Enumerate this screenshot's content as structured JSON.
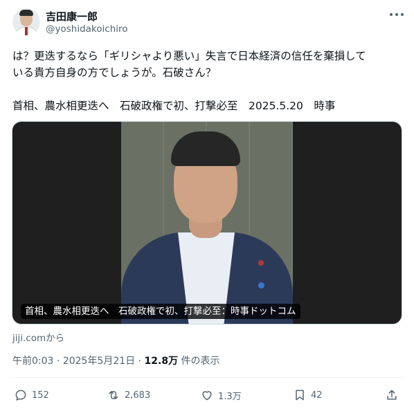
{
  "author": {
    "display_name": "吉田康一郎",
    "handle": "@yoshidakoichiro"
  },
  "tweet": {
    "text": "は？更迭するなら「ギリシャより悪い」失言で日本経済の信任を棄損して\nいる貴方自身の方でしょうが。石破さん？",
    "headline": "首相、農水相更迭へ　石破政権で初、打撃必至　2025.5.20　時事"
  },
  "media": {
    "caption": "首相、農水相更迭へ　石破政権で初、打撃必至：時事ドットコム",
    "source": "jiji.comから"
  },
  "meta": {
    "time": "午前0:03",
    "separator": " · ",
    "date": "2025年5月21日",
    "views_count": "12.8万",
    "views_label": " 件の表示"
  },
  "actions": {
    "replies": "152",
    "retweets": "2,683",
    "likes": "1.3万",
    "bookmarks": "42"
  },
  "icons": {
    "more": "more-horizontal-icon",
    "reply": "reply-icon",
    "retweet": "retweet-icon",
    "like": "heart-icon",
    "bookmark": "bookmark-icon",
    "share": "share-icon"
  },
  "colors": {
    "text": "#0f1419",
    "secondary": "#536471",
    "border": "#eff3f4"
  }
}
